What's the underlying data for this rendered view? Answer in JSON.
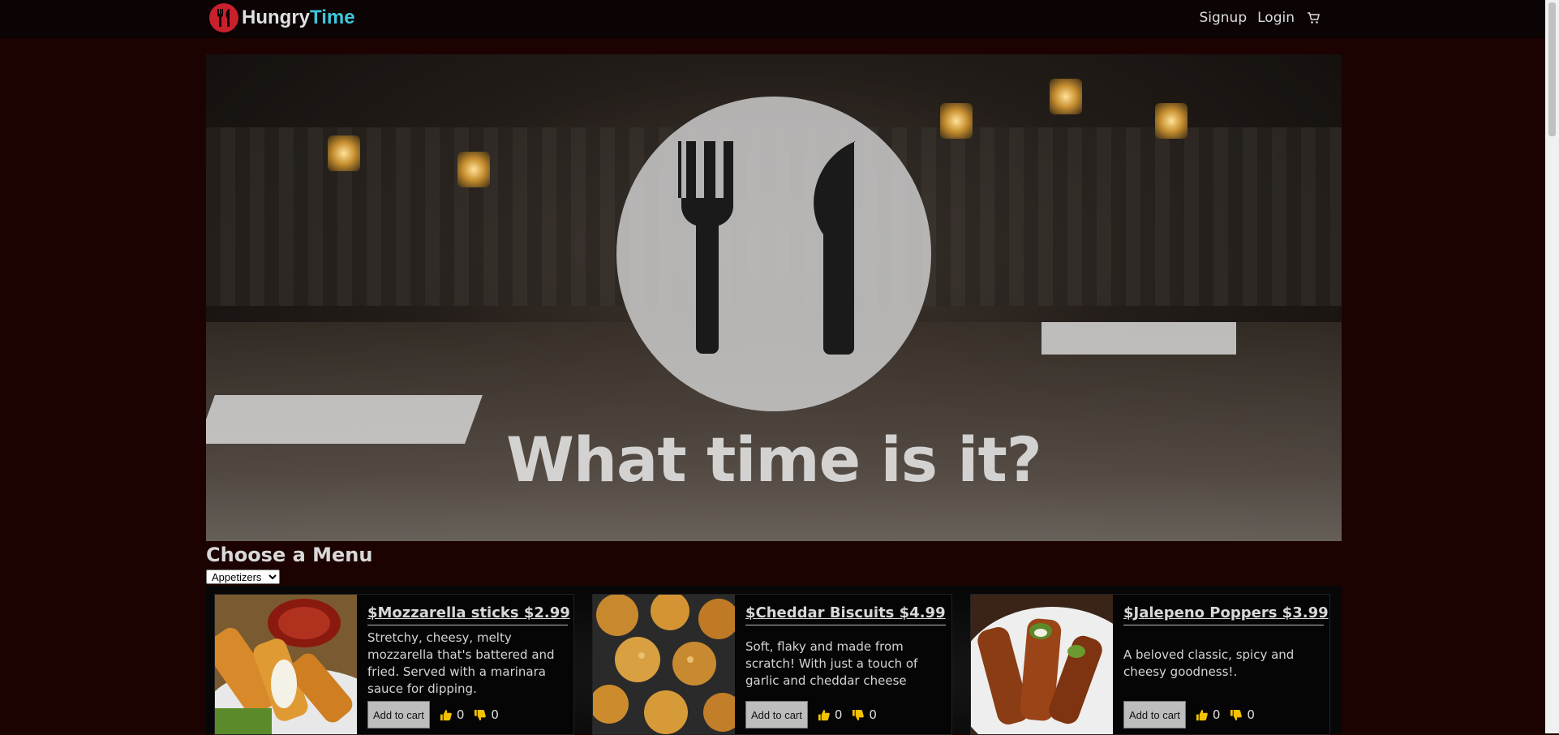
{
  "brand": {
    "name_part1": "Hungry",
    "name_part2": "Time",
    "logo_icon": "fork-knife-icon",
    "colors": {
      "red": "#c8202c",
      "cyan": "#3fc6dc"
    }
  },
  "nav": {
    "signup": "Signup",
    "login": "Login",
    "cart_icon": "shopping-cart-icon"
  },
  "hero": {
    "heading": "What time is it?",
    "icon": "fork-knife-icon"
  },
  "menu": {
    "title": "Choose a Menu",
    "selected": "Appetizers"
  },
  "items": [
    {
      "title": "$Mozzarella sticks $2.99",
      "description": "Stretchy, cheesy, melty mozzarella that's battered and fried. Served with a marinara sauce for dipping.",
      "add_label": "Add to cart",
      "likes": "0",
      "dislikes": "0"
    },
    {
      "title": "$Cheddar Biscuits $4.99",
      "description": "Soft, flaky and made from scratch! With just a touch of garlic and cheddar cheese",
      "add_label": "Add to cart",
      "likes": "0",
      "dislikes": "0"
    },
    {
      "title": "$Jalepeno Poppers $3.99",
      "description": "A beloved classic, spicy and cheesy goodness!.",
      "add_label": "Add to cart",
      "likes": "0",
      "dislikes": "0"
    }
  ]
}
